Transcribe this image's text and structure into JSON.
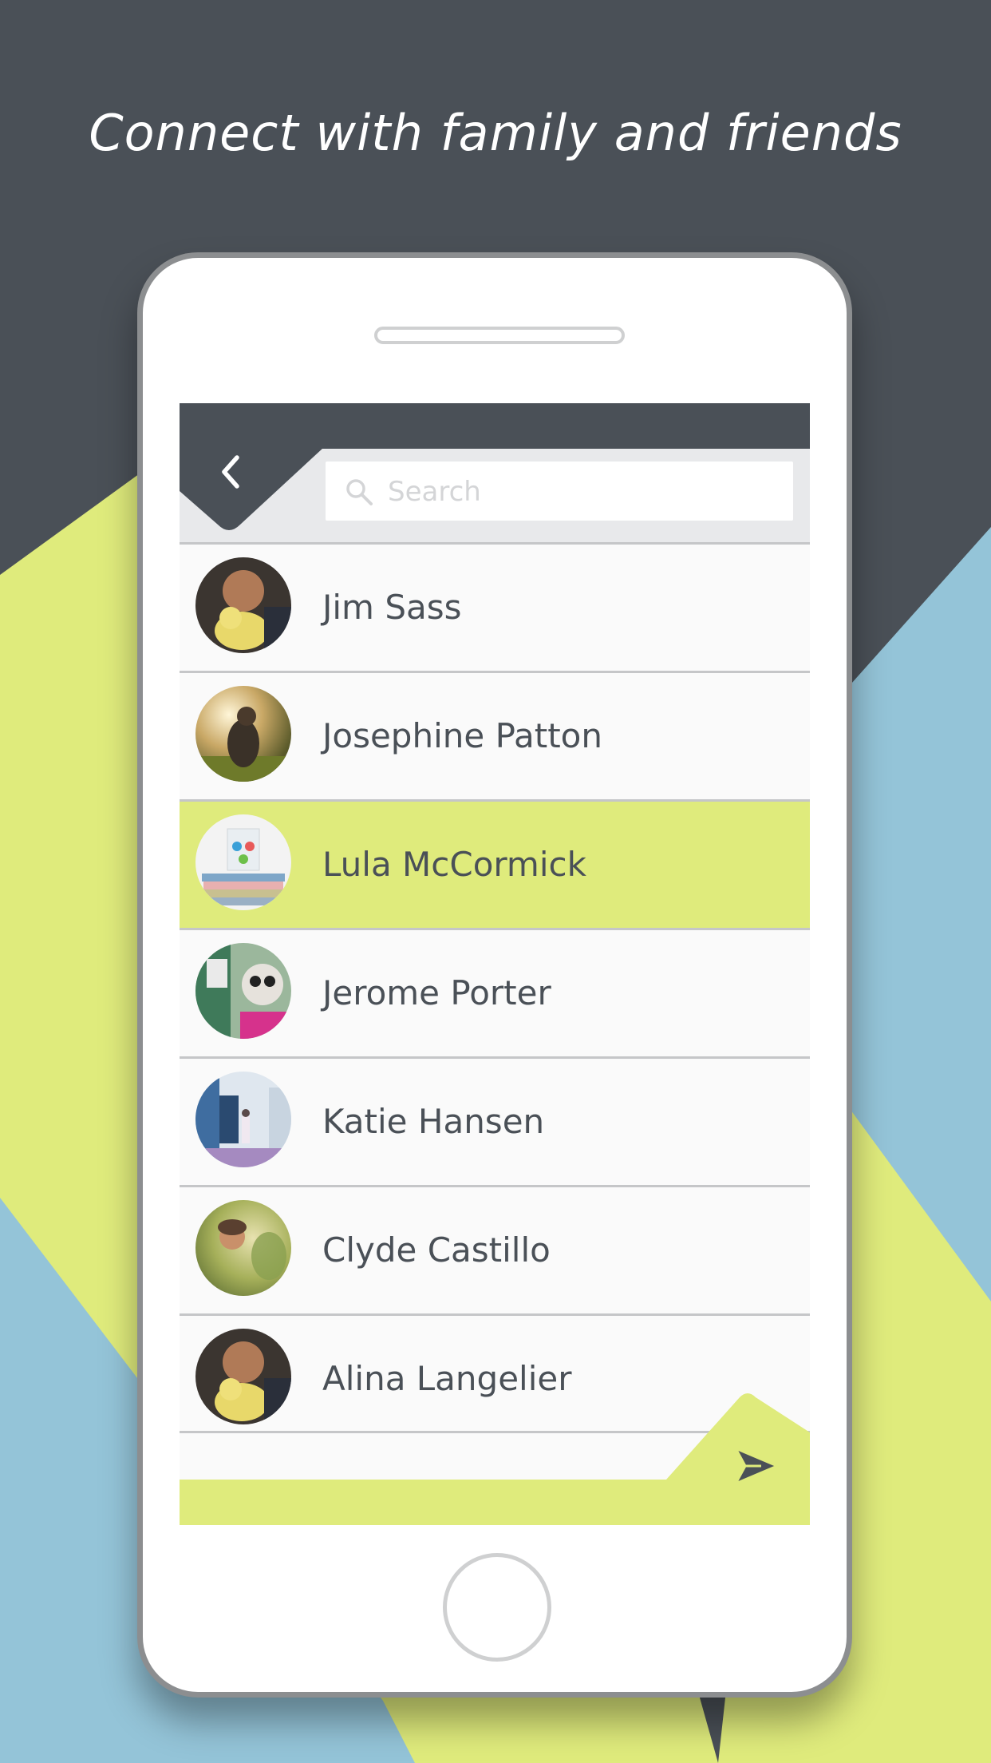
{
  "tagline": "Connect with family and friends",
  "colors": {
    "dark": "#4a5057",
    "lime": "#dfeb7c",
    "sky": "#94c4d8",
    "list_bg": "#fafafa",
    "divider": "#c5c6c8"
  },
  "header": {
    "back_icon": "chevron-left-icon",
    "search": {
      "placeholder": "Search",
      "value": "",
      "icon": "search-icon"
    }
  },
  "contacts": [
    {
      "name": "Jim Sass",
      "selected": false
    },
    {
      "name": "Josephine Patton",
      "selected": false
    },
    {
      "name": "Lula McCormick",
      "selected": true
    },
    {
      "name": "Jerome Porter",
      "selected": false
    },
    {
      "name": "Katie Hansen",
      "selected": false
    },
    {
      "name": "Clyde Castillo",
      "selected": false
    },
    {
      "name": "Alina Langelier",
      "selected": false
    }
  ],
  "footer": {
    "send_icon": "send-icon"
  }
}
